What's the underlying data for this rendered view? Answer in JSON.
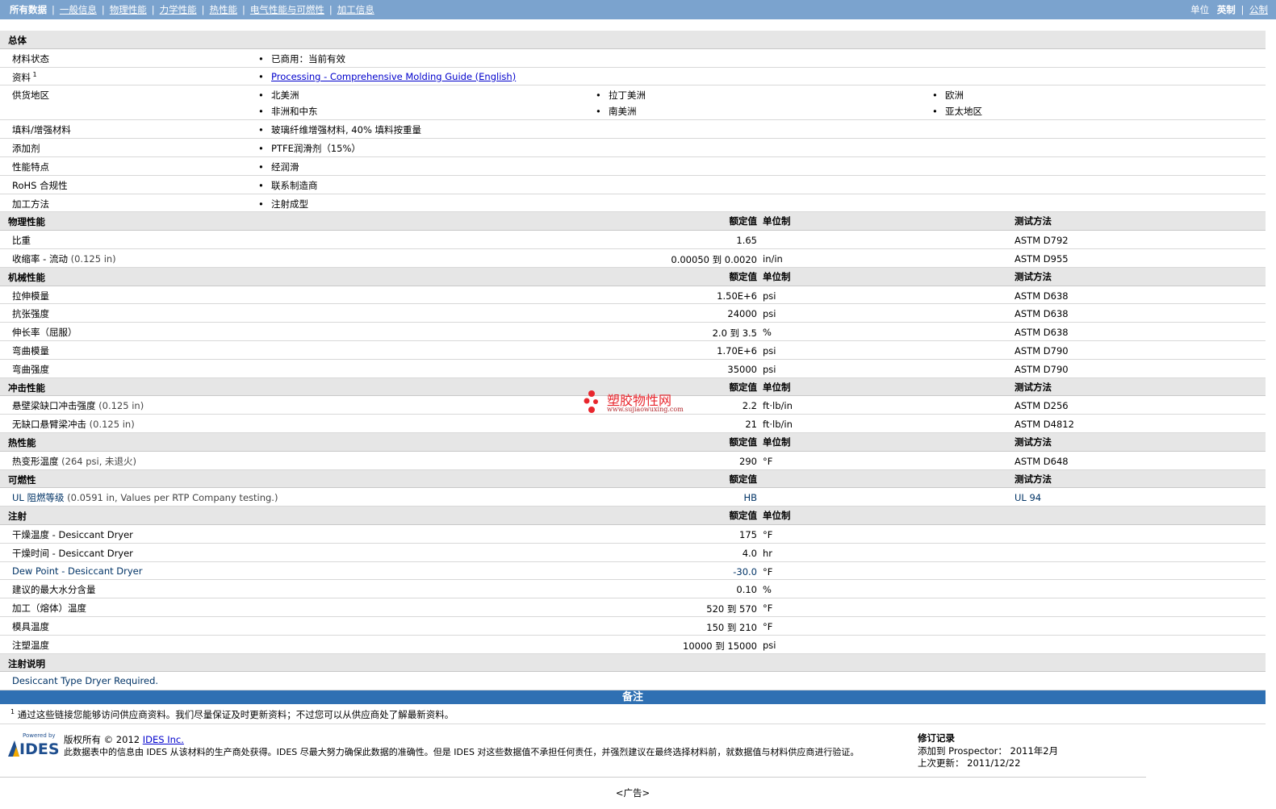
{
  "nav": {
    "tabs": [
      "所有数据",
      "一般信息",
      "物理性能",
      "力学性能",
      "热性能",
      "电气性能与可燃性",
      "加工信息"
    ],
    "unit_label": "单位",
    "unit_options": [
      "英制",
      "公制"
    ]
  },
  "general": {
    "title": "总体",
    "rows": [
      {
        "label": "材料状态",
        "values": [
          "已商用：当前有效"
        ]
      },
      {
        "label": "资料",
        "sup": "1",
        "link": "Processing - Comprehensive Molding Guide (English)"
      },
      {
        "label": "供货地区",
        "grid": [
          [
            "北美洲",
            "拉丁美洲",
            "欧洲"
          ],
          [
            "非洲和中东",
            "南美洲",
            "亚太地区"
          ]
        ]
      },
      {
        "label": "填料/增强材料",
        "values": [
          "玻璃纤维增强材料, 40% 填料按重量"
        ]
      },
      {
        "label": "添加剂",
        "values": [
          "PTFE润滑剂（15%）"
        ]
      },
      {
        "label": "性能特点",
        "values": [
          "经润滑"
        ]
      },
      {
        "label": "RoHS 合规性",
        "values": [
          "联系制造商"
        ]
      },
      {
        "label": "加工方法",
        "values": [
          "注射成型"
        ]
      }
    ]
  },
  "headers": {
    "value": "额定值",
    "unit": "单位制",
    "method": "测试方法"
  },
  "sections": [
    {
      "title": "物理性能",
      "show_unit": true,
      "show_method": true,
      "rows": [
        {
          "label": "比重",
          "value": "1.65",
          "unit": "",
          "method": "ASTM D792"
        },
        {
          "label": "收缩率 - 流动",
          "cond": "(0.125 in)",
          "value": "0.00050 到  0.0020",
          "unit": "in/in",
          "method": "ASTM D955"
        }
      ]
    },
    {
      "title": "机械性能",
      "show_unit": true,
      "show_method": true,
      "rows": [
        {
          "label": "拉伸模量",
          "value": "1.50E+6",
          "unit": "psi",
          "method": "ASTM D638"
        },
        {
          "label": "抗张强度",
          "value": "24000",
          "unit": "psi",
          "method": "ASTM D638"
        },
        {
          "label": "伸长率（屈服）",
          "value": "2.0 到  3.5",
          "unit": "%",
          "method": "ASTM D638"
        },
        {
          "label": "弯曲模量",
          "value": "1.70E+6",
          "unit": "psi",
          "method": "ASTM D790"
        },
        {
          "label": "弯曲强度",
          "value": "35000",
          "unit": "psi",
          "method": "ASTM D790"
        }
      ]
    },
    {
      "title": "冲击性能",
      "show_unit": true,
      "show_method": true,
      "rows": [
        {
          "label": "悬壁梁缺口冲击强度",
          "cond": "(0.125 in)",
          "value": "2.2",
          "unit": "ft·lb/in",
          "method": "ASTM D256"
        },
        {
          "label": "无缺口悬臂梁冲击",
          "cond": "(0.125 in)",
          "value": "21",
          "unit": "ft·lb/in",
          "method": "ASTM D4812"
        }
      ]
    },
    {
      "title": "热性能",
      "show_unit": true,
      "show_method": true,
      "rows": [
        {
          "label": "热变形温度",
          "cond": "(264 psi, 未退火)",
          "value": "290",
          "unit": "°F",
          "method": "ASTM D648"
        }
      ]
    },
    {
      "title": "可燃性",
      "show_unit": false,
      "show_method": true,
      "rows": [
        {
          "label": "UL 阻燃等级",
          "cond": "(0.0591 in, Values per RTP Company testing.)",
          "value": "HB",
          "unit": "",
          "method": "UL 94",
          "blue": true
        }
      ]
    },
    {
      "title": "注射",
      "show_unit": true,
      "show_method": false,
      "rows": [
        {
          "label": "干燥温度 - Desiccant Dryer",
          "value": "175",
          "unit": "°F",
          "method": ""
        },
        {
          "label": "干燥时间 - Desiccant Dryer",
          "value": "4.0",
          "unit": "hr",
          "method": ""
        },
        {
          "label": "Dew Point - Desiccant Dryer",
          "value": "-30.0",
          "unit": "°F",
          "method": "",
          "blue": true
        },
        {
          "label": "建议的最大水分含量",
          "value": "0.10",
          "unit": "%",
          "method": ""
        },
        {
          "label": "加工（熔体）温度",
          "value": "520 到  570",
          "unit": "°F",
          "method": ""
        },
        {
          "label": "模具温度",
          "value": "150 到  210",
          "unit": "°F",
          "method": ""
        },
        {
          "label": "注塑温度",
          "value": "10000 到  15000",
          "unit": "psi",
          "method": ""
        }
      ]
    }
  ],
  "injection_notes": {
    "title": "注射说明",
    "text": "Desiccant Type Dryer Required."
  },
  "notes": {
    "title": "备注",
    "sup": "1",
    "text": "通过这些链接您能够访问供应商资料。我们尽量保证及时更新资料；不过您可以从供应商处了解最新资料。"
  },
  "watermark": {
    "name": "塑胶物性网",
    "url": "www.sujiaowuxing.com"
  },
  "footer": {
    "logo_small": "Powered by",
    "logo": "IDES",
    "copyright": "版权所有 © 2012",
    "company_link": "IDES Inc.",
    "disclaimer": "此数据表中的信息由 IDES 从该材料的生产商处获得。IDES 尽最大努力确保此数据的准确性。但是 IDES 对这些数据值不承担任何责任，并强烈建议在最终选择材料前，就数据值与材料供应商进行验证。",
    "revision_title": "修订记录",
    "added_label": "添加到 Prospector：",
    "added_value": "2011年2月",
    "updated_label": "上次更新：",
    "updated_value": "2011/12/22"
  },
  "ad": "<广告>",
  "colors": {
    "topbar": "#7BA3CE",
    "notesbar": "#2F70B3",
    "section": "#E6E6E6"
  }
}
